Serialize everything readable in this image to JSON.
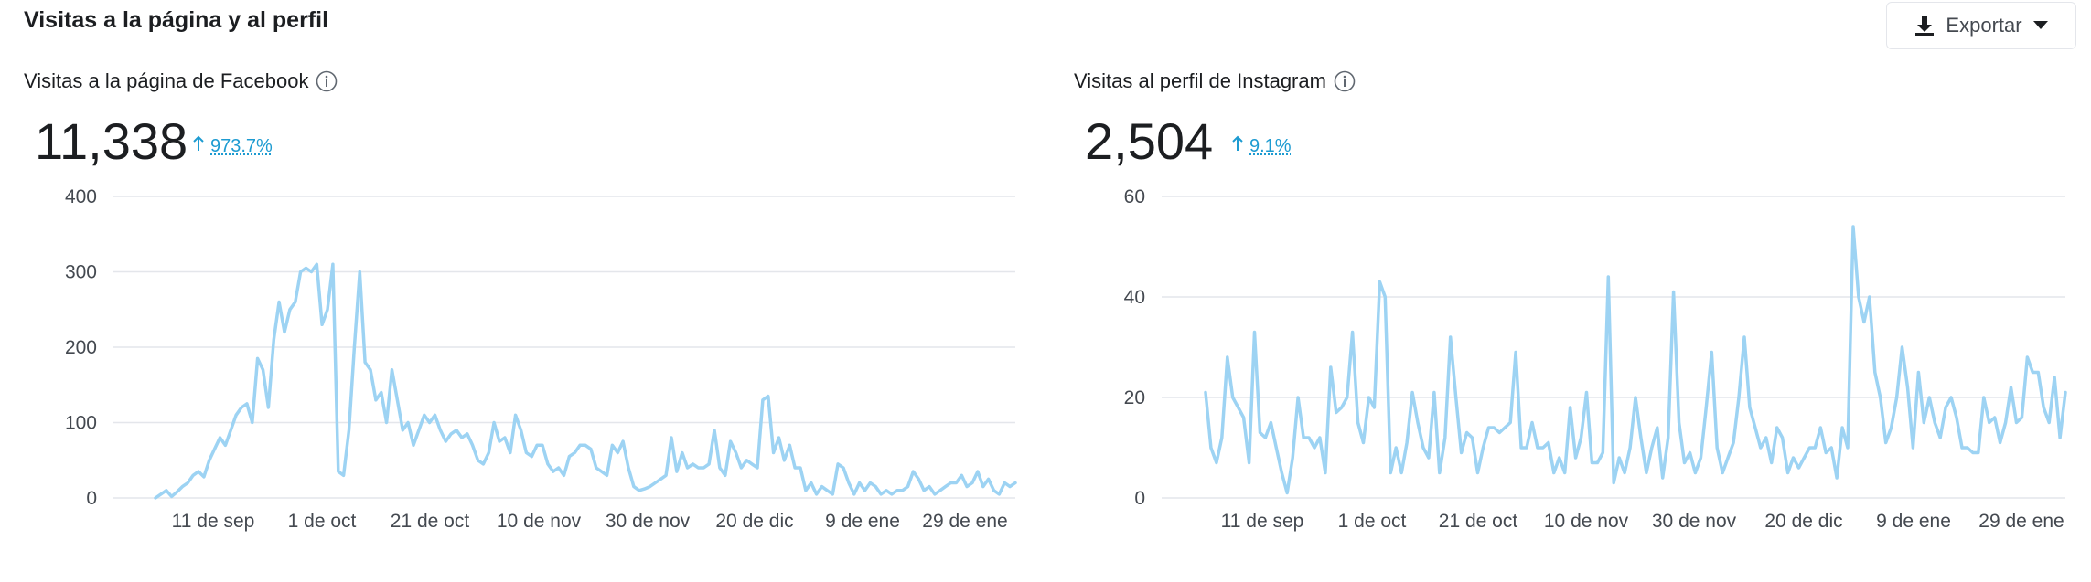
{
  "section": {
    "title": "Visitas a la página y al perfil",
    "export_label": "Exportar"
  },
  "facebook": {
    "title": "Visitas a la página de Facebook",
    "total": "11,338",
    "delta": "973.7%"
  },
  "instagram": {
    "title": "Visitas al perfil de Instagram",
    "total": "2,504",
    "delta": "9.1%"
  },
  "colors": {
    "line": "#9dd3f3",
    "grid": "#e4e6eb",
    "delta": "#1d9bd1"
  },
  "chart_data": [
    {
      "type": "line",
      "ylim": [
        0,
        400
      ],
      "y_ticks": [
        0,
        100,
        200,
        300,
        400
      ],
      "x_tick_labels": [
        "11 de sep",
        "1 de oct",
        "21 de oct",
        "10 de nov",
        "30 de nov",
        "20 de dic",
        "9 de ene",
        "29 de ene"
      ],
      "start_date": "2021-08-31",
      "values": [
        0,
        5,
        10,
        2,
        8,
        15,
        20,
        30,
        35,
        28,
        50,
        65,
        80,
        70,
        90,
        110,
        120,
        125,
        100,
        185,
        170,
        120,
        210,
        260,
        220,
        250,
        260,
        300,
        305,
        300,
        310,
        230,
        250,
        310,
        35,
        30,
        90,
        200,
        300,
        180,
        170,
        130,
        140,
        100,
        170,
        130,
        90,
        100,
        70,
        90,
        110,
        100,
        110,
        90,
        75,
        85,
        90,
        80,
        85,
        70,
        50,
        45,
        60,
        100,
        75,
        80,
        60,
        110,
        90,
        60,
        55,
        70,
        70,
        45,
        35,
        40,
        30,
        55,
        60,
        70,
        70,
        65,
        40,
        35,
        30,
        70,
        60,
        75,
        40,
        15,
        10,
        12,
        15,
        20,
        25,
        30,
        80,
        35,
        60,
        40,
        45,
        40,
        40,
        45,
        90,
        40,
        30,
        75,
        60,
        40,
        50,
        45,
        40,
        130,
        135,
        60,
        80,
        50,
        70,
        40,
        40,
        10,
        20,
        5,
        15,
        10,
        5,
        45,
        40,
        20,
        5,
        20,
        10,
        20,
        15,
        5,
        10,
        5,
        10,
        10,
        15,
        35,
        25,
        10,
        15,
        5,
        10,
        15,
        20,
        20,
        30,
        15,
        20,
        35,
        15,
        25,
        10,
        5,
        20,
        15,
        20
      ]
    },
    {
      "type": "line",
      "ylim": [
        0,
        60
      ],
      "y_ticks": [
        0,
        20,
        40,
        60
      ],
      "x_tick_labels": [
        "11 de sep",
        "1 de oct",
        "21 de oct",
        "10 de nov",
        "30 de nov",
        "20 de dic",
        "9 de ene",
        "29 de ene"
      ],
      "start_date": "2021-08-31",
      "values": [
        21,
        10,
        7,
        12,
        28,
        20,
        18,
        16,
        7,
        33,
        13,
        12,
        15,
        10,
        5,
        1,
        8,
        20,
        12,
        12,
        10,
        12,
        5,
        26,
        17,
        18,
        20,
        33,
        15,
        11,
        20,
        18,
        43,
        40,
        5,
        10,
        5,
        11,
        21,
        15,
        10,
        8,
        21,
        5,
        12,
        32,
        20,
        9,
        13,
        12,
        5,
        10,
        14,
        14,
        13,
        14,
        15,
        29,
        10,
        10,
        15,
        10,
        10,
        11,
        5,
        8,
        5,
        18,
        8,
        12,
        21,
        7,
        7,
        9,
        44,
        3,
        8,
        5,
        10,
        20,
        12,
        5,
        10,
        14,
        4,
        12,
        41,
        15,
        7,
        9,
        5,
        8,
        18,
        29,
        10,
        5,
        8,
        11,
        20,
        32,
        18,
        14,
        10,
        12,
        7,
        14,
        12,
        5,
        8,
        6,
        8,
        10,
        10,
        14,
        9,
        10,
        4,
        14,
        10,
        54,
        40,
        35,
        40,
        25,
        20,
        11,
        14,
        20,
        30,
        22,
        10,
        25,
        15,
        20,
        15,
        12,
        18,
        20,
        16,
        10,
        10,
        9,
        9,
        20,
        15,
        16,
        11,
        15,
        22,
        15,
        16,
        28,
        25,
        25,
        18,
        15,
        24,
        12,
        21
      ]
    }
  ]
}
